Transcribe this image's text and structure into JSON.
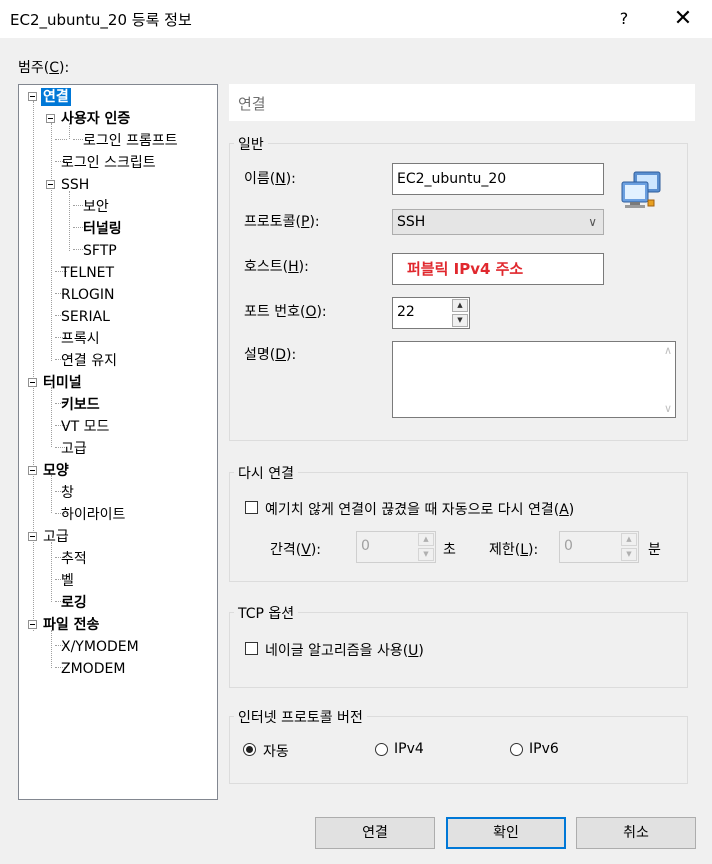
{
  "window": {
    "title": "EC2_ubuntu_20 등록 정보",
    "help_label": "?",
    "close_label": "✕"
  },
  "category": {
    "label_pre": "범주(",
    "label_key": "C",
    "label_post": "):",
    "items": [
      {
        "label": "연결"
      },
      {
        "label": "사용자 인증"
      },
      {
        "label": "로그인 프롬프트"
      },
      {
        "label": "로그인 스크립트"
      },
      {
        "label": "SSH"
      },
      {
        "label": "보안"
      },
      {
        "label": "터널링"
      },
      {
        "label": "SFTP"
      },
      {
        "label": "TELNET"
      },
      {
        "label": "RLOGIN"
      },
      {
        "label": "SERIAL"
      },
      {
        "label": "프록시"
      },
      {
        "label": "연결 유지"
      },
      {
        "label": "터미널"
      },
      {
        "label": "키보드"
      },
      {
        "label": "VT 모드"
      },
      {
        "label": "고급"
      },
      {
        "label": "모양"
      },
      {
        "label": "창"
      },
      {
        "label": "하이라이트"
      },
      {
        "label": "고급"
      },
      {
        "label": "추적"
      },
      {
        "label": "벨"
      },
      {
        "label": "로깅"
      },
      {
        "label": "파일 전송"
      },
      {
        "label": "X/YMODEM"
      },
      {
        "label": "ZMODEM"
      }
    ]
  },
  "panel": {
    "header": "연결",
    "general": {
      "title": "일반",
      "name_pre": "이름(",
      "name_key": "N",
      "name_post": "):",
      "name_value": "EC2_ubuntu_20",
      "protocol_pre": "프로토콜(",
      "protocol_key": "P",
      "protocol_post": "):",
      "protocol_value": "SSH",
      "host_pre": "호스트(",
      "host_key": "H",
      "host_post": "):",
      "host_value": "퍼블릭 IPv4 주소",
      "port_pre": "포트 번호(",
      "port_key": "O",
      "port_post": "):",
      "port_value": "22",
      "desc_pre": "설명(",
      "desc_key": "D",
      "desc_post": "):",
      "desc_value": ""
    },
    "reconnect": {
      "title": "다시 연결",
      "checkbox_pre": "예기치 않게 연결이 끊겼을 때 자동으로 다시 연결(",
      "checkbox_key": "A",
      "checkbox_post": ")",
      "interval_pre": "간격(",
      "interval_key": "V",
      "interval_post": "):",
      "interval_value": "0",
      "interval_unit": "초",
      "limit_pre": "제한(",
      "limit_key": "L",
      "limit_post": "):",
      "limit_value": "0",
      "limit_unit": "분"
    },
    "tcp": {
      "title": "TCP 옵션",
      "checkbox_pre": "네이글 알고리즘을 사용(",
      "checkbox_key": "U",
      "checkbox_post": ")"
    },
    "ip": {
      "title": "인터넷 프로토콜 버전",
      "options": [
        {
          "label": "자동",
          "selected": true
        },
        {
          "label": "IPv4",
          "selected": false
        },
        {
          "label": "IPv6",
          "selected": false
        }
      ]
    }
  },
  "buttons": {
    "connect": "연결",
    "ok": "확인",
    "cancel": "취소"
  }
}
